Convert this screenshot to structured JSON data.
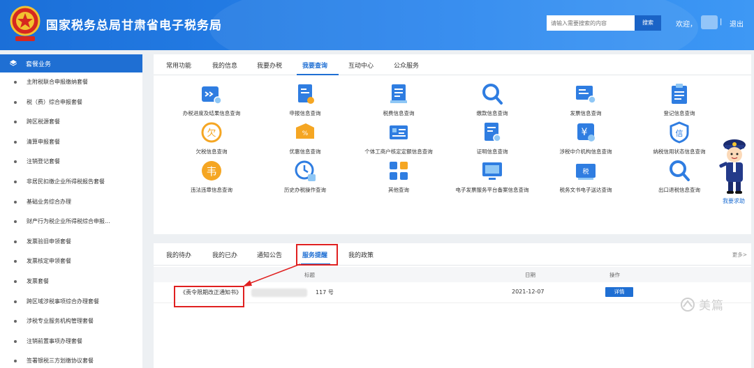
{
  "header": {
    "title": "国家税务总局甘肃省电子税务局",
    "search_placeholder": "请输入需要搜索的内容",
    "search_button": "搜索",
    "welcome": "欢迎，",
    "divider": "|",
    "logout": "退出"
  },
  "sidebar": {
    "title": "套餐业务",
    "items": [
      "主附税联合申报缴纳套餐",
      "税（费）综合申报套餐",
      "跨区税源套餐",
      "清算申报套餐",
      "注销登记套餐",
      "非居民扣缴企业所得税报告套餐",
      "基础业务综合办理",
      "财产行为税企业所得税综合申报...",
      "发票验旧申领套餐",
      "发票核定申领套餐",
      "发票套餐",
      "跨区域涉税事项综合办理套餐",
      "涉税专业服务机构管理套餐",
      "注销前置事项办理套餐",
      "签署银税三方划缴协议套餐"
    ]
  },
  "top_tabs": [
    {
      "label": "常用功能",
      "active": false
    },
    {
      "label": "我的信息",
      "active": false
    },
    {
      "label": "我要办税",
      "active": false
    },
    {
      "label": "我要查询",
      "active": true
    },
    {
      "label": "互动中心",
      "active": false
    },
    {
      "label": "公众服务",
      "active": false
    }
  ],
  "query_items": [
    {
      "label": "办税进度及结果信息查询",
      "icon": "progress-search-icon"
    },
    {
      "label": "申报信息查询",
      "icon": "declaration-doc-icon"
    },
    {
      "label": "税费信息查询",
      "icon": "tax-fee-doc-icon"
    },
    {
      "label": "缴款信息查询",
      "icon": "magnifier-icon"
    },
    {
      "label": "发票信息查询",
      "icon": "invoice-search-icon"
    },
    {
      "label": "登记信息查询",
      "icon": "clipboard-icon"
    },
    {
      "label": "欠税信息查询",
      "icon": "owed-tax-icon"
    },
    {
      "label": "优惠信息查询",
      "icon": "discount-tag-icon"
    },
    {
      "label": "个体工商户核定定额信息查询",
      "icon": "merchant-card-icon"
    },
    {
      "label": "证明信息查询",
      "icon": "certificate-search-icon"
    },
    {
      "label": "涉税中介机构信息查询",
      "icon": "agency-yen-icon"
    },
    {
      "label": "纳税信用状态信息查询",
      "icon": "credit-seal-icon"
    },
    {
      "label": "违法违章信息查询",
      "icon": "violation-tax-icon"
    },
    {
      "label": "历史办税操作查询",
      "icon": "history-clock-icon"
    },
    {
      "label": "其他查询",
      "icon": "grid-apps-icon"
    },
    {
      "label": "电子发票服务平台备案信息查询",
      "icon": "einvoice-platform-icon"
    },
    {
      "label": "税务文书电子送达查询",
      "icon": "tax-document-icon"
    },
    {
      "label": "出口退税信息查询",
      "icon": "export-refund-search-icon"
    }
  ],
  "help_label": "我要求助",
  "bottom_tabs": [
    {
      "label": "我的待办",
      "active": false
    },
    {
      "label": "我的已办",
      "active": false
    },
    {
      "label": "通知公告",
      "active": false
    },
    {
      "label": "服务提醒",
      "active": true
    },
    {
      "label": "我的政策",
      "active": false
    }
  ],
  "more_label": "更多>",
  "table": {
    "headers": {
      "title": "标题",
      "date": "日期",
      "action": "操作"
    },
    "rows": [
      {
        "title_prefix": "《责令限期改正通知书》",
        "title_suffix": "117 号",
        "date": "2021-12-07",
        "action": "详情"
      }
    ]
  },
  "watermark": "美篇",
  "colors": {
    "header_blue": "#1b6fd8",
    "accent_blue": "#1f6fd3",
    "icon_light_blue": "#8fc7f5",
    "highlight_red": "#e02020"
  }
}
